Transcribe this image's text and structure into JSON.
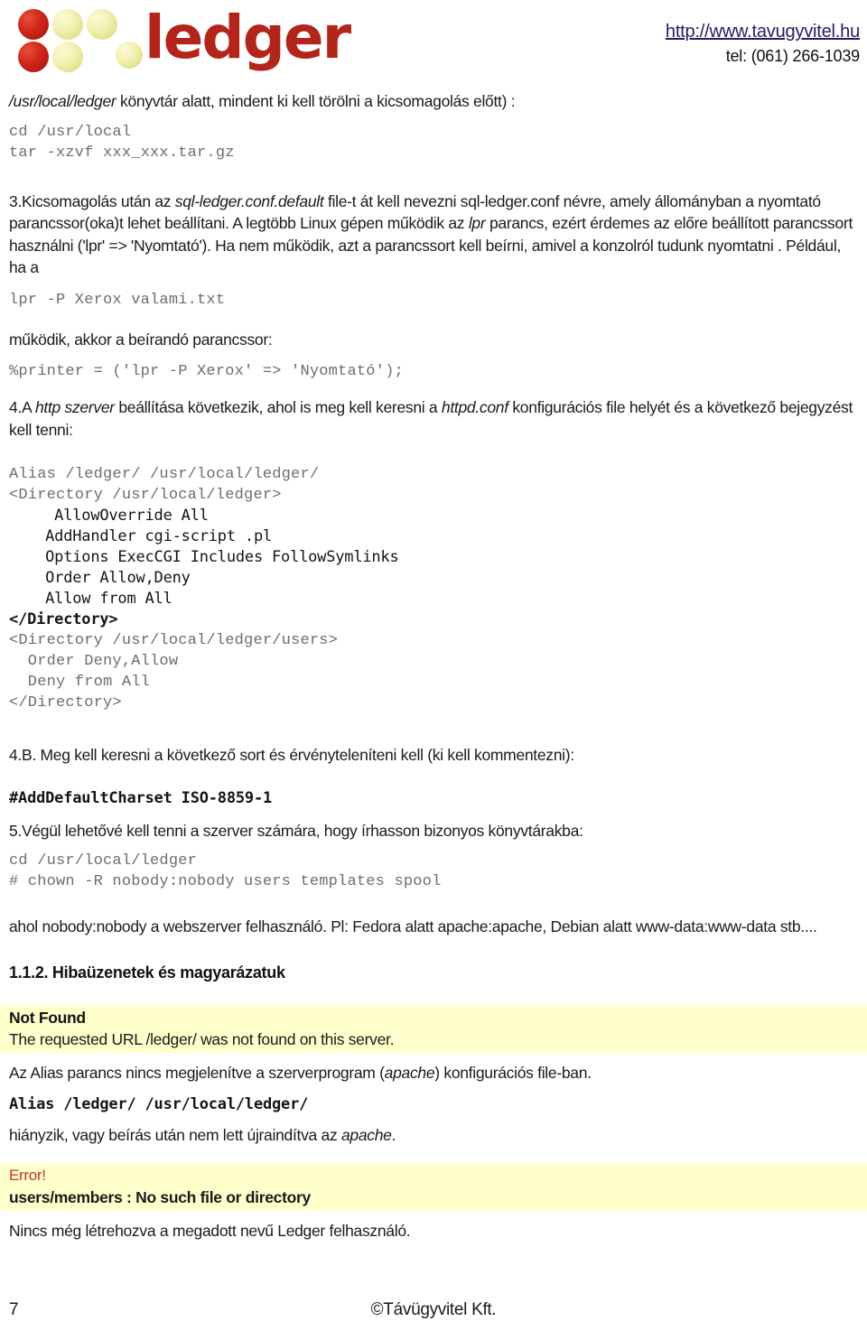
{
  "header": {
    "logo_text": "ledger",
    "logo_alt": "ledger-logo",
    "url": "http://www.tavugyvitel.hu",
    "tel": "tel: (061) 266-1039",
    "colors": {
      "logo_red": "#b3241a",
      "dot_red": "#d0291b",
      "dot_cream": "#f2efae",
      "url_blue": "#211f62",
      "highlight_yellow": "#ffffcc",
      "error_red": "#c1392b"
    }
  },
  "body": {
    "intro_path": "/usr/local/ledger",
    "intro_rest": " könyvtár alatt, mindent ki kell törölni a kicsomagolás előtt) :",
    "code_cd_local": "cd /usr/local",
    "code_tar": "tar -xzvf xxx_xxx.tar.gz",
    "step3_a": "3.Kicsomagolás után az ",
    "step3_i1": "sql-ledger.conf.default",
    "step3_b": " file-t át kell nevezni sql-ledger.conf névre, amely állományban a nyomtató parancssor(oka)t lehet beállítani. A legtöbb Linux gépen működik az ",
    "step3_i2": "lpr",
    "step3_c": " parancs, ezért érdemes az előre beállított parancssort használni ('lpr' => 'Nyomtató'). Ha nem működik, azt a parancssort kell beírni, amivel a konzolról tudunk nyomtatni . Például, ha a",
    "code_lpr": "lpr -P Xerox valami.txt",
    "step3_d": "működik, akkor a beírandó parancssor:",
    "code_printer": "%printer = ('lpr -P Xerox' => 'Nyomtató');",
    "step4a_a": "4.A ",
    "step4a_i1": "http szerver",
    "step4a_b": " beállítása következik, ahol is meg kell keresni a ",
    "step4a_i2": "httpd.conf",
    "step4a_c": " konfigurációs file helyét és a következő bejegyzést kell tenni:",
    "apache_conf": [
      {
        "text": "Alias /ledger/ /usr/local/ledger/",
        "style": "serif"
      },
      {
        "text": "<Directory /usr/local/ledger>",
        "style": "serif"
      },
      {
        "text": "     AllowOverride All",
        "style": "sans"
      },
      {
        "text": "    AddHandler cgi-script .pl",
        "style": "sans"
      },
      {
        "text": "    Options ExecCGI Includes FollowSymlinks",
        "style": "sans"
      },
      {
        "text": "    Order Allow,Deny",
        "style": "sans"
      },
      {
        "text": "    Allow from All",
        "style": "sans"
      },
      {
        "text": "</Directory>",
        "style": "sans-bold"
      },
      {
        "text": "<Directory /usr/local/ledger/users>",
        "style": "serif"
      },
      {
        "text": "  Order Deny,Allow",
        "style": "serif"
      },
      {
        "text": "  Deny from All",
        "style": "serif"
      },
      {
        "text": "</Directory>",
        "style": "serif"
      }
    ],
    "step4b": "4.B. Meg kell keresni a következő sort és érvényteleníteni kell  (ki kell kommentezni):",
    "code_charset": "#AddDefaultCharset ISO-8859-1",
    "step5": "5.Végül lehetővé kell tenni a szerver számára, hogy írhasson bizonyos könyvtárakba:",
    "code_cd_ledger": "cd /usr/local/ledger",
    "code_chown": "# chown -R nobody:nobody users templates spool",
    "step5_note": "ahol nobody:nobody a webszerver felhasználó. Pl: Fedora alatt apache:apache, Debian alatt www-data:www-data stb....",
    "section_title": "1.1.2. Hibaüzenetek és magyarázatuk",
    "err1_title": "Not Found",
    "err1_line": "The requested URL /ledger/ was not found on this server.",
    "err1_expl_a": "Az Alias parancs nincs megjelenítve a szerverprogram (",
    "err1_expl_i": "apache",
    "err1_expl_b": ") konfigurációs file-ban.",
    "err1_code": "Alias /ledger/ /usr/local/ledger/",
    "err1_expl2_a": "hiányzik, vagy beírás után nem lett újraindítva az ",
    "err1_expl2_i": "apache",
    "err1_expl2_b": ".",
    "err2_title": "Error!",
    "err2_line": "users/members : No such file or directory",
    "err2_expl": "Nincs még létrehozva a megadott nevű Ledger felhasználó."
  },
  "footer": {
    "page_number": "7",
    "copyright": "©Távügyvitel Kft."
  }
}
